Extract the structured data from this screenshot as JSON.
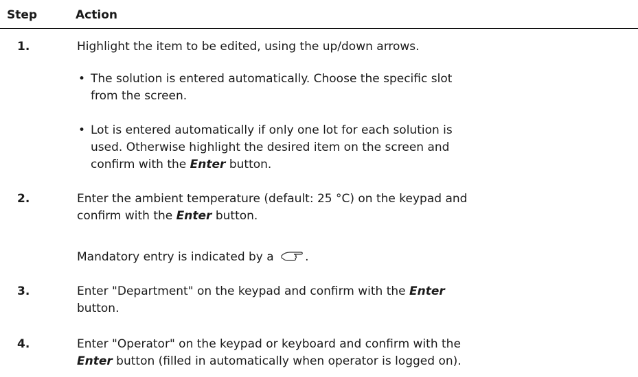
{
  "table": {
    "headers": {
      "step": "Step",
      "action": "Action"
    },
    "rows": [
      {
        "num": "1.",
        "text": "Highlight the item to be edited, using the up/down arrows.",
        "bullets": [
          {
            "line1": "The solution is entered automatically. Choose the specific slot",
            "line2": "from the screen."
          },
          {
            "line1": "Lot is entered automatically if only one lot for each solution is",
            "line2": "used. Otherwise highlight the desired item on the screen and",
            "line3_pre": "confirm with the ",
            "line3_bold": "Enter",
            "line3_post": " button."
          }
        ]
      },
      {
        "num": "2.",
        "line1": "Enter the ambient temperature (default: 25 °C) on the keypad and",
        "line2_pre": "confirm with the ",
        "line2_bold": "Enter",
        "line2_post": " button.",
        "note_pre": "Mandatory entry is indicated by a ",
        "note_post": ".",
        "note_icon": "pointing-hand-icon"
      },
      {
        "num": "3.",
        "line1_pre": "Enter \"Department\" on the keypad and confirm with the ",
        "line1_bold": "Enter",
        "line2": "button."
      },
      {
        "num": "4.",
        "line1": "Enter \"Operator\" on the keypad or keyboard and confirm with the",
        "line2_bold": "Enter",
        "line2_post": " button (filled in automatically when operator is logged on)."
      }
    ]
  }
}
